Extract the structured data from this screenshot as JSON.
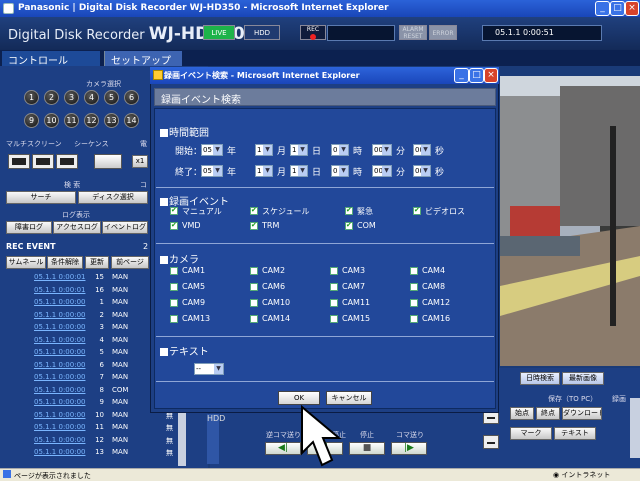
{
  "browser": {
    "title": "Panasonic | Digital Disk Recorder WJ-HD350 - Microsoft Internet Explorer",
    "status_text": "ページが表示されました",
    "zone_text": "イントラネット",
    "buttons": [
      "_",
      "□",
      "×"
    ]
  },
  "header": {
    "prefix": "Digital Disk Recorder",
    "model": "WJ-HD350",
    "live": "LIVE",
    "hdd": "HDD",
    "rec": "REC",
    "alarm": "ALARM RESET",
    "error": "ERROR",
    "clock": "05.1.1  0:00:51"
  },
  "tabs": {
    "control": "コントロール",
    "setup": "セットアップ"
  },
  "left": {
    "camera_select": "カメラ選択",
    "cameras_row1": [
      "1",
      "2",
      "3",
      "4",
      "5",
      "6"
    ],
    "cameras_row2": [
      "9",
      "10",
      "11",
      "12",
      "13",
      "14"
    ],
    "multiscreen": "マルチスクリーン",
    "sequence": "シーケンス",
    "zoom_prefix": "電",
    "zoom_btn": "x1",
    "search_title": "検 索",
    "search_btn": "サーチ",
    "disk_select_btn": "ディスク選択",
    "comment_prefix": "コ",
    "log_title": "ログ表示",
    "fault_log": "障害ログ",
    "access_log": "アクセスログ",
    "event_log": "イベントログ",
    "rec_event_title": "REC EVENT",
    "rec_event_num": "2",
    "thumbnail_btn": "サムネール",
    "clear_filter_btn": "条件解除",
    "refresh_btn": "更新",
    "prev_page_btn": "前ページ",
    "events": [
      {
        "dt": "05.1.1 0:00:01",
        "num": "15",
        "typ": "MAN",
        "mk": ""
      },
      {
        "dt": "05.1.1 0:00:01",
        "num": "16",
        "typ": "MAN",
        "mk": ""
      },
      {
        "dt": "05.1.1 0:00:00",
        "num": "1",
        "typ": "MAN",
        "mk": ""
      },
      {
        "dt": "05.1.1 0:00:00",
        "num": "2",
        "typ": "MAN",
        "mk": ""
      },
      {
        "dt": "05.1.1 0:00:00",
        "num": "3",
        "typ": "MAN",
        "mk": ""
      },
      {
        "dt": "05.1.1 0:00:00",
        "num": "4",
        "typ": "MAN",
        "mk": ""
      },
      {
        "dt": "05.1.1 0:00:00",
        "num": "5",
        "typ": "MAN",
        "mk": ""
      },
      {
        "dt": "05.1.1 0:00:00",
        "num": "6",
        "typ": "MAN",
        "mk": ""
      },
      {
        "dt": "05.1.1 0:00:00",
        "num": "7",
        "typ": "MAN",
        "mk": ""
      },
      {
        "dt": "05.1.1 0:00:00",
        "num": "8",
        "typ": "COM",
        "mk": ""
      },
      {
        "dt": "05.1.1 0:00:00",
        "num": "9",
        "typ": "MAN",
        "mk": ""
      },
      {
        "dt": "05.1.1 0:00:00",
        "num": "10",
        "typ": "MAN",
        "mk": "無"
      },
      {
        "dt": "05.1.1 0:00:00",
        "num": "11",
        "typ": "MAN",
        "mk": "無"
      },
      {
        "dt": "05.1.1 0:00:00",
        "num": "12",
        "typ": "MAN",
        "mk": "無"
      },
      {
        "dt": "05.1.1 0:00:00",
        "num": "13",
        "typ": "MAN",
        "mk": "無"
      }
    ]
  },
  "right": {
    "date_search_btn": "日時検索",
    "latest_image_btn": "最新画像",
    "copy_title": "保存（TO PC）",
    "rec_label": "録画",
    "start_btn": "始点",
    "end_btn": "終点",
    "download_btn": "ダウンロード",
    "mark_btn": "マーク",
    "text_btn": "テキスト",
    "hdd_label": "HDD",
    "reverse_label": "逆コマ送り",
    "pause_label": "一時停止",
    "stop_label": "停止",
    "forward_label": "コマ送り"
  },
  "dialog": {
    "title": "録画イベント検索 - Microsoft Internet Explorer",
    "heading": "録画イベント検索",
    "time_range": "時間範囲",
    "start_label": "開始：",
    "end_label": "終了：",
    "start": {
      "year": "05",
      "month": "1",
      "day": "1",
      "hour": "0",
      "minute": "00",
      "second": "00"
    },
    "end": {
      "year": "05",
      "month": "1",
      "day": "1",
      "hour": "0",
      "minute": "00",
      "second": "00"
    },
    "units": {
      "year": "年",
      "month": "月",
      "day": "日",
      "hour": "時",
      "minute": "分",
      "second": "秒"
    },
    "rec_event": "録画イベント",
    "events": [
      {
        "label": "マニュアル",
        "checked": true
      },
      {
        "label": "スケジュール",
        "checked": true
      },
      {
        "label": "緊急",
        "checked": true
      },
      {
        "label": "ビデオロス",
        "checked": true
      },
      {
        "label": "VMD",
        "checked": true
      },
      {
        "label": "TRM",
        "checked": true
      },
      {
        "label": "COM",
        "checked": true
      }
    ],
    "camera": "カメラ",
    "cameras": [
      "CAM1",
      "CAM2",
      "CAM3",
      "CAM4",
      "CAM5",
      "CAM6",
      "CAM7",
      "CAM8",
      "CAM9",
      "CAM10",
      "CAM11",
      "CAM12",
      "CAM13",
      "CAM14",
      "CAM15",
      "CAM16"
    ],
    "text": "テキスト",
    "text_select": "--",
    "ok": "OK",
    "cancel": "キャンセル"
  },
  "colors": {
    "accent": "#1d3f84",
    "title_blue": "#2b62d8",
    "check_green": "#1a9a1a"
  }
}
